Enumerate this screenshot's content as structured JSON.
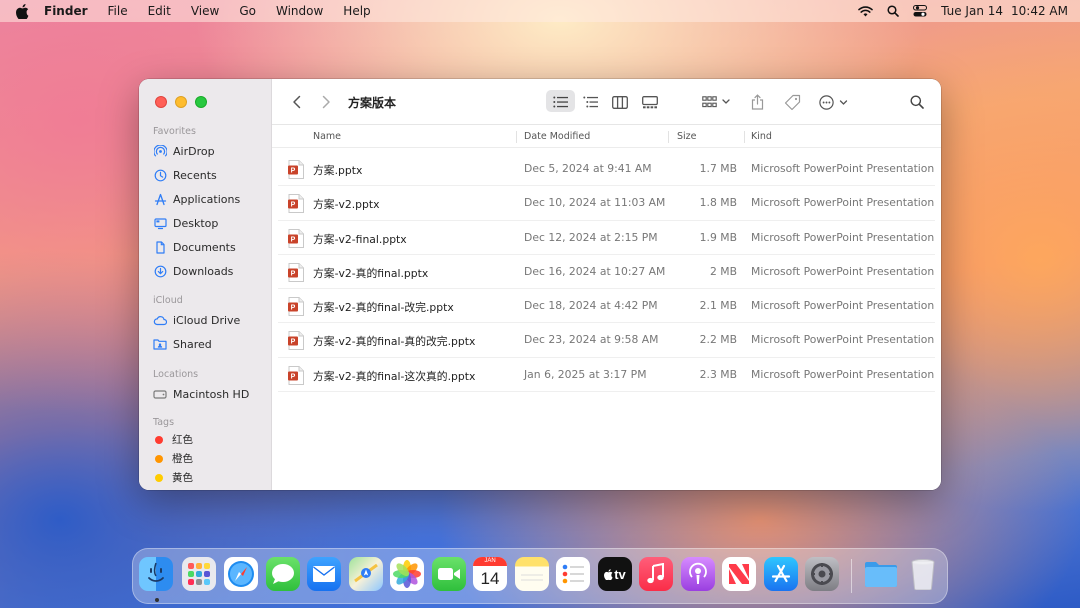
{
  "menubar": {
    "app_name": "Finder",
    "menus": [
      "File",
      "Edit",
      "View",
      "Go",
      "Window",
      "Help"
    ],
    "date": "Tue Jan 14",
    "time": "10:42 AM"
  },
  "window": {
    "title": "方案版本",
    "sidebar": {
      "favorites_heading": "Favorites",
      "favorites": [
        {
          "label": "AirDrop",
          "icon": "airdrop-icon"
        },
        {
          "label": "Recents",
          "icon": "clock-icon"
        },
        {
          "label": "Applications",
          "icon": "applications-icon"
        },
        {
          "label": "Desktop",
          "icon": "desktop-icon"
        },
        {
          "label": "Documents",
          "icon": "document-icon"
        },
        {
          "label": "Downloads",
          "icon": "download-icon"
        }
      ],
      "icloud_heading": "iCloud",
      "icloud": [
        {
          "label": "iCloud Drive",
          "icon": "cloud-icon"
        },
        {
          "label": "Shared",
          "icon": "shared-folder-icon"
        }
      ],
      "locations_heading": "Locations",
      "locations": [
        {
          "label": "Macintosh HD",
          "icon": "disk-icon"
        }
      ],
      "tags_heading": "Tags",
      "tags": [
        {
          "label": "红色",
          "color": "#ff3b30"
        },
        {
          "label": "橙色",
          "color": "#ff9500"
        },
        {
          "label": "黄色",
          "color": "#ffcc00"
        }
      ]
    },
    "columns": {
      "name": "Name",
      "date": "Date Modified",
      "size": "Size",
      "kind": "Kind"
    },
    "files": [
      {
        "name": "方案.pptx",
        "date": "Dec 5, 2024 at 9:41 AM",
        "size": "1.7 MB",
        "kind": "Microsoft PowerPoint Presentation"
      },
      {
        "name": "方案-v2.pptx",
        "date": "Dec 10, 2024 at 11:03 AM",
        "size": "1.8 MB",
        "kind": "Microsoft PowerPoint Presentation"
      },
      {
        "name": "方案-v2-final.pptx",
        "date": "Dec 12, 2024 at 2:15 PM",
        "size": "1.9 MB",
        "kind": "Microsoft PowerPoint Presentation"
      },
      {
        "name": "方案-v2-真的final.pptx",
        "date": "Dec 16, 2024 at 10:27 AM",
        "size": "2 MB",
        "kind": "Microsoft PowerPoint Presentation"
      },
      {
        "name": "方案-v2-真的final-改完.pptx",
        "date": "Dec 18, 2024 at 4:42 PM",
        "size": "2.1 MB",
        "kind": "Microsoft PowerPoint Presentation"
      },
      {
        "name": "方案-v2-真的final-真的改完.pptx",
        "date": "Dec 23, 2024 at 9:58 AM",
        "size": "2.2 MB",
        "kind": "Microsoft PowerPoint Presentation"
      },
      {
        "name": "方案-v2-真的final-这次真的.pptx",
        "date": "Jan 6, 2025 at 3:17 PM",
        "size": "2.3 MB",
        "kind": "Microsoft PowerPoint Presentation"
      }
    ]
  },
  "dock": {
    "calendar_month": "JAN",
    "calendar_day": "14",
    "tv_label": "tv",
    "apps": [
      "Finder",
      "Launchpad",
      "Safari",
      "Messages",
      "Mail",
      "Maps",
      "Photos",
      "FaceTime",
      "Calendar",
      "Notes",
      "Reminders",
      "TV",
      "Music",
      "Podcasts",
      "News",
      "App Store",
      "System Settings",
      "Folder",
      "Trash"
    ]
  }
}
